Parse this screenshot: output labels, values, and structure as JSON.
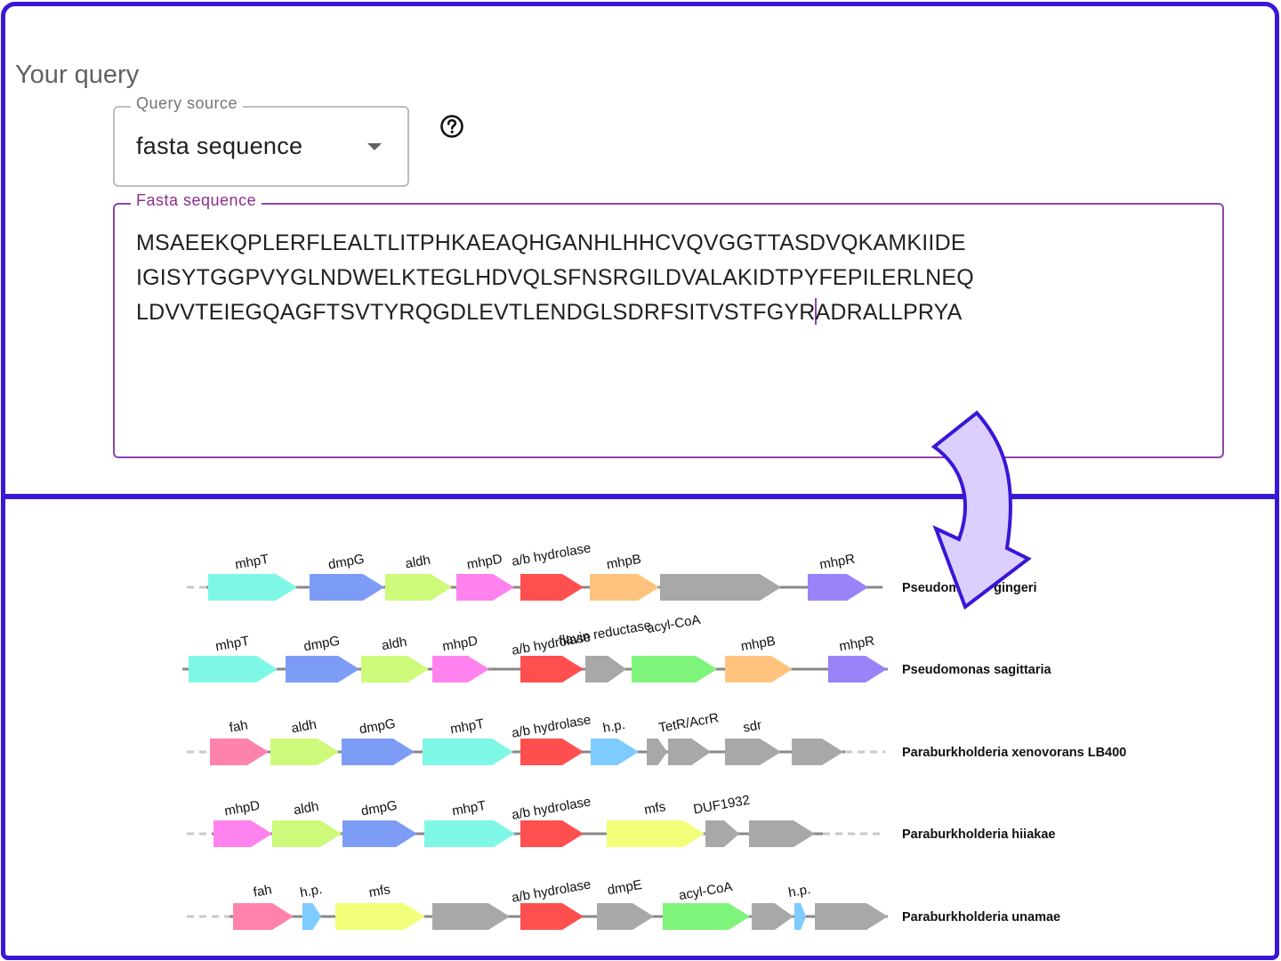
{
  "query": {
    "title": "Your query",
    "source_label": "Query source",
    "source_value": "fasta sequence",
    "fasta_label": "Fasta sequence",
    "fasta_lines": [
      "MSAEEKQPLERFLEALTLITPHKAEAQHGANHLHHCVQVGGTTASDVQKAMKIIDE",
      "IGISYTGGPVYGLNDWELKTEGLHDVQLSFNSRGILDVALAKIDTPYFEPILERLNEQ",
      "LDVVTEIEGQAGFTSVTYRQGDLEVTLENDGLSDRFSITVSTFGYR",
      "ADRALLPRYA"
    ]
  },
  "colors": {
    "border": "#3a16d6",
    "arrow_fill": "#dccfff",
    "backbone": "#888888",
    "gene": {
      "teal": "#7ff7e6",
      "blue": "#7c9cf5",
      "lime": "#cdfa7a",
      "pink": "#ff82ee",
      "red": "#ff4f4f",
      "orange": "#ffc37d",
      "gray": "#a8a8a8",
      "purple": "#9a82f8",
      "green": "#7ff47a",
      "salmon": "#ff82ac",
      "sky": "#7dcbff",
      "yellow": "#f1ff79"
    }
  },
  "clusters": [
    {
      "organism": "Pseudomonas gingeri",
      "genes": [
        {
          "label": "mhpT",
          "color": "teal"
        },
        {
          "label": "dmpG",
          "color": "blue"
        },
        {
          "label": "aldh",
          "color": "lime"
        },
        {
          "label": "mhpD",
          "color": "pink"
        },
        {
          "label": "a/b hydrolase",
          "color": "red"
        },
        {
          "label": "mhpB",
          "color": "orange"
        },
        {
          "label": "",
          "color": "gray"
        },
        {
          "label": "mhpR",
          "color": "purple"
        }
      ]
    },
    {
      "organism": "Pseudomonas sagittaria",
      "genes": [
        {
          "label": "mhpT",
          "color": "teal"
        },
        {
          "label": "dmpG",
          "color": "blue"
        },
        {
          "label": "aldh",
          "color": "lime"
        },
        {
          "label": "mhpD",
          "color": "pink"
        },
        {
          "label": "a/b hydrolase",
          "color": "red"
        },
        {
          "label": "flavin reductase",
          "color": "gray"
        },
        {
          "label": "acyl-CoA",
          "color": "green"
        },
        {
          "label": "mhpB",
          "color": "orange"
        },
        {
          "label": "mhpR",
          "color": "purple"
        }
      ]
    },
    {
      "organism": "Paraburkholderia xenovorans LB400",
      "genes": [
        {
          "label": "fah",
          "color": "salmon"
        },
        {
          "label": "aldh",
          "color": "lime"
        },
        {
          "label": "dmpG",
          "color": "blue"
        },
        {
          "label": "mhpT",
          "color": "teal"
        },
        {
          "label": "a/b hydrolase",
          "color": "red"
        },
        {
          "label": "h.p.",
          "color": "sky"
        },
        {
          "label": "",
          "color": "gray"
        },
        {
          "label": "TetR/AcrR",
          "color": "gray"
        },
        {
          "label": "sdr",
          "color": "gray"
        },
        {
          "label": "",
          "color": "gray"
        }
      ]
    },
    {
      "organism": "Paraburkholderia hiiakae",
      "genes": [
        {
          "label": "mhpD",
          "color": "pink"
        },
        {
          "label": "aldh",
          "color": "lime"
        },
        {
          "label": "dmpG",
          "color": "blue"
        },
        {
          "label": "mhpT",
          "color": "teal"
        },
        {
          "label": "a/b hydrolase",
          "color": "red"
        },
        {
          "label": "mfs",
          "color": "yellow"
        },
        {
          "label": "DUF1932",
          "color": "gray"
        },
        {
          "label": "",
          "color": "gray"
        }
      ]
    },
    {
      "organism": "Paraburkholderia unamae",
      "genes": [
        {
          "label": "fah",
          "color": "salmon"
        },
        {
          "label": "h.p.",
          "color": "sky"
        },
        {
          "label": "mfs",
          "color": "yellow"
        },
        {
          "label": "",
          "color": "gray"
        },
        {
          "label": "a/b hydrolase",
          "color": "red"
        },
        {
          "label": "dmpE",
          "color": "gray"
        },
        {
          "label": "acyl-CoA",
          "color": "green"
        },
        {
          "label": "",
          "color": "gray"
        },
        {
          "label": "h.p.",
          "color": "sky"
        },
        {
          "label": "",
          "color": "gray"
        }
      ]
    }
  ]
}
